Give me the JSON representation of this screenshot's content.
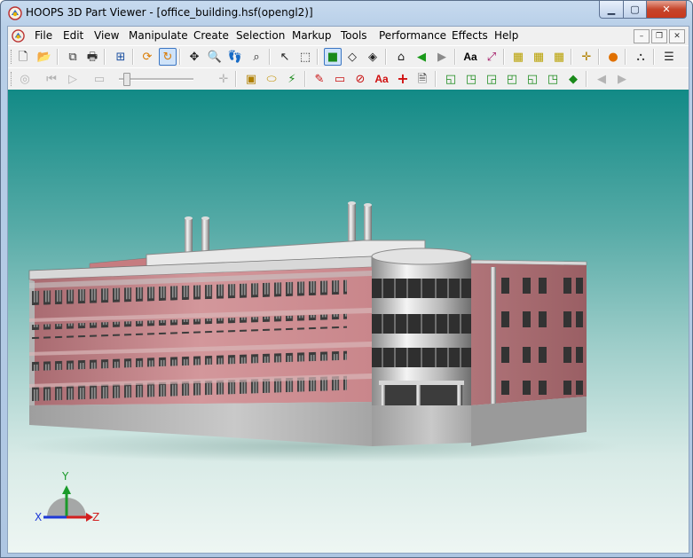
{
  "window": {
    "title": "HOOPS 3D Part Viewer - [office_building.hsf(opengl2)]",
    "caption_buttons": {
      "minimize": "▁",
      "maximize": "▢",
      "close": "✕"
    }
  },
  "menu": {
    "items": [
      "File",
      "Edit",
      "View",
      "Manipulate",
      "Create",
      "Selection",
      "Markup",
      "Tools",
      "Performance",
      "Effects",
      "Help"
    ],
    "mdi_buttons": {
      "minimize": "–",
      "restore": "❐",
      "close": "✕"
    }
  },
  "toolbar1": {
    "buttons": [
      {
        "name": "new-file-icon",
        "glyph": "🗋"
      },
      {
        "name": "open-file-icon",
        "glyph": "📂"
      },
      {
        "name": "copy-icon",
        "glyph": "⧉"
      },
      {
        "name": "print-icon",
        "glyph": "🖶"
      },
      {
        "name": "fit-window-icon",
        "glyph": "⊞"
      },
      {
        "name": "orbit-icon",
        "glyph": "⟳"
      },
      {
        "name": "turntable-icon",
        "glyph": "↻"
      },
      {
        "name": "pan-icon",
        "glyph": "✥"
      },
      {
        "name": "zoom-icon",
        "glyph": "🔍"
      },
      {
        "name": "walk-icon",
        "glyph": "👣"
      },
      {
        "name": "zoom-window-icon",
        "glyph": "⌕"
      },
      {
        "name": "select-icon",
        "glyph": "↖"
      },
      {
        "name": "area-select-icon",
        "glyph": "⬚"
      },
      {
        "name": "shaded-icon",
        "glyph": "■"
      },
      {
        "name": "hidden-line-icon",
        "glyph": "◇"
      },
      {
        "name": "wireframe-icon",
        "glyph": "◈"
      },
      {
        "name": "home-view-icon",
        "glyph": "⌂"
      },
      {
        "name": "back-view-icon",
        "glyph": "◀"
      },
      {
        "name": "forward-view-icon",
        "glyph": "▶"
      },
      {
        "name": "text-icon",
        "glyph": "Aa"
      },
      {
        "name": "measure-icon",
        "glyph": "⤢"
      },
      {
        "name": "grid-icon",
        "glyph": "▦"
      },
      {
        "name": "grid-xy-icon",
        "glyph": "▦"
      },
      {
        "name": "grid-z-icon",
        "glyph": "▦"
      },
      {
        "name": "point-light-icon",
        "glyph": "✛"
      },
      {
        "name": "sphere-icon",
        "glyph": "●"
      },
      {
        "name": "connections-icon",
        "glyph": "⛬"
      },
      {
        "name": "list-icon",
        "glyph": "☰"
      }
    ]
  },
  "toolbar2": {
    "buttons": [
      {
        "name": "record-icon",
        "glyph": "◎"
      },
      {
        "name": "rewind-icon",
        "glyph": "⏮"
      },
      {
        "name": "play-icon",
        "glyph": "▷"
      },
      {
        "name": "stop-icon",
        "glyph": "▭"
      },
      {
        "name": "add-keyframe-icon",
        "glyph": "✛"
      },
      {
        "name": "box-section-icon",
        "glyph": "▣"
      },
      {
        "name": "cutting-plane-icon",
        "glyph": "⬭"
      },
      {
        "name": "section-icon",
        "glyph": "⚡"
      },
      {
        "name": "freehand-markup-icon",
        "glyph": "✎"
      },
      {
        "name": "rectangle-markup-icon",
        "glyph": "▭"
      },
      {
        "name": "circle-markup-icon",
        "glyph": "⊘"
      },
      {
        "name": "text-markup-icon",
        "glyph": "Aa"
      },
      {
        "name": "cross-markup-icon",
        "glyph": "+"
      },
      {
        "name": "note-icon",
        "glyph": "🗎"
      },
      {
        "name": "view-front-icon",
        "glyph": "◱"
      },
      {
        "name": "view-back-icon",
        "glyph": "◳"
      },
      {
        "name": "view-left-icon",
        "glyph": "◲"
      },
      {
        "name": "view-right-icon",
        "glyph": "◰"
      },
      {
        "name": "view-top-icon",
        "glyph": "◱"
      },
      {
        "name": "view-bottom-icon",
        "glyph": "◳"
      },
      {
        "name": "iso-view-icon",
        "glyph": "◆"
      },
      {
        "name": "previous-icon",
        "glyph": "◀"
      },
      {
        "name": "next-icon",
        "glyph": "▶"
      }
    ]
  },
  "axes": {
    "x": "X",
    "y": "Y",
    "z": "Z"
  },
  "colors": {
    "accent": "#3b76c3",
    "background_top": "#128a86",
    "background_bottom": "#eef6f3",
    "facade": "#c8868a",
    "axis_x": "#1f3ad6",
    "axis_y": "#1a9a2a",
    "axis_z": "#d21f1f"
  }
}
